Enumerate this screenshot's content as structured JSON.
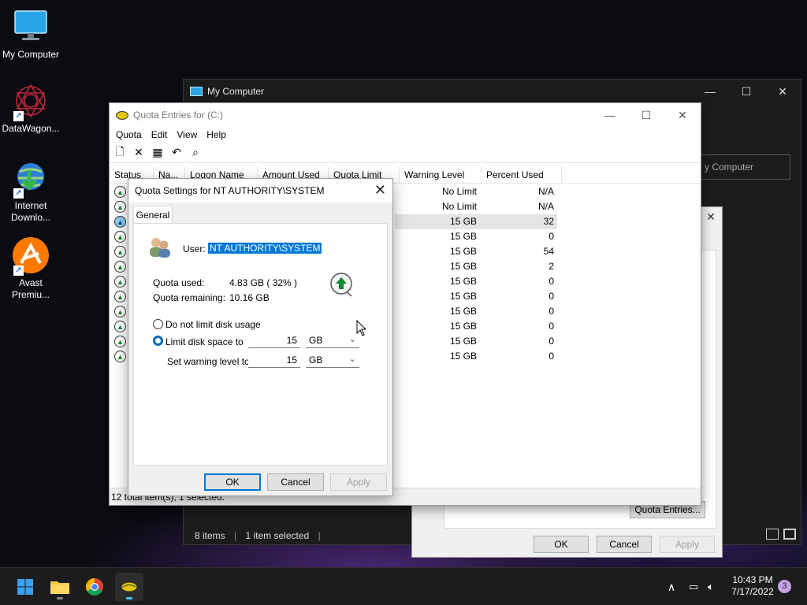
{
  "desktop": {
    "icons": [
      {
        "label": "My Computer"
      },
      {
        "label": "DataWagon..."
      },
      {
        "label": "Internet Downlo..."
      },
      {
        "label": "Avast Premiu..."
      }
    ]
  },
  "explorer": {
    "title": "My Computer",
    "search_partial": "y Computer",
    "items_count": "8 items",
    "selected_count": "1 item selected"
  },
  "properties": {
    "quota_entries_button": "Quota Entries...",
    "ok": "OK",
    "cancel": "Cancel",
    "apply": "Apply"
  },
  "quota_entries": {
    "title": "Quota Entries for  (C:)",
    "menu": [
      "Quota",
      "Edit",
      "View",
      "Help"
    ],
    "columns": [
      "Status",
      "Na...",
      "Logon Name",
      "Amount Used",
      "Quota Limit",
      "Warning Level",
      "Percent Used"
    ],
    "rows": [
      {
        "warning": "No Limit",
        "percent": "N/A",
        "status": "ok"
      },
      {
        "warning": "No Limit",
        "percent": "N/A",
        "status": "ok"
      },
      {
        "warning": "15 GB",
        "percent": "32",
        "status": "warn",
        "selected": true
      },
      {
        "warning": "15 GB",
        "percent": "0",
        "status": "ok"
      },
      {
        "warning": "15 GB",
        "percent": "54",
        "status": "ok"
      },
      {
        "warning": "15 GB",
        "percent": "2",
        "status": "ok"
      },
      {
        "warning": "15 GB",
        "percent": "0",
        "status": "ok"
      },
      {
        "warning": "15 GB",
        "percent": "0",
        "status": "ok"
      },
      {
        "warning": "15 GB",
        "percent": "0",
        "status": "ok"
      },
      {
        "warning": "15 GB",
        "percent": "0",
        "status": "ok"
      },
      {
        "warning": "15 GB",
        "percent": "0",
        "status": "ok"
      },
      {
        "warning": "15 GB",
        "percent": "0",
        "status": "ok"
      }
    ],
    "status_bar": "12 total item(s), 1 selected."
  },
  "quota_settings": {
    "title": "Quota Settings for NT AUTHORITY\\SYSTEM",
    "tab": "General",
    "user_label": "User:",
    "user_value": "NT AUTHORITY\\SYSTEM",
    "quota_used_label": "Quota used:",
    "quota_used_value": "4.83 GB ( 32% )",
    "quota_remaining_label": "Quota remaining:",
    "quota_remaining_value": "10.16 GB",
    "no_limit_label": "Do not limit disk usage",
    "limit_label": "Limit disk space to",
    "limit_value": "15",
    "limit_unit": "GB",
    "warning_label": "Set warning level to",
    "warning_value": "15",
    "warning_unit": "GB",
    "ok": "OK",
    "cancel": "Cancel",
    "apply": "Apply"
  },
  "taskbar": {
    "time": "10:43 PM",
    "date": "7/17/2022",
    "notification_count": "3"
  }
}
